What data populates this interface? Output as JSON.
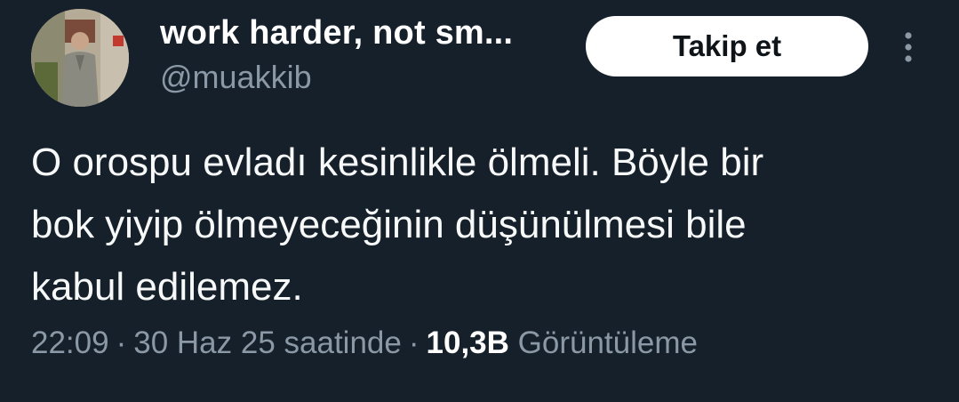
{
  "user": {
    "display_name": "work harder, not sm...",
    "handle": "@muakkib"
  },
  "follow_button": {
    "label": "Takip et"
  },
  "more_button": {
    "icon": "more-vertical-icon"
  },
  "tweet": {
    "text_lines": [
      "O orospu evladı kesinlikle ölmeli. Böyle bir",
      "bok yiyip ölmeyeceğinin düşünülmesi bile",
      "kabul edilemez."
    ]
  },
  "meta": {
    "time": "22:09",
    "separator": "·",
    "date": "30 Haz 25 saatinde",
    "views_count": "10,3B",
    "views_label": "Görüntüleme"
  },
  "colors": {
    "background": "#15202b",
    "text_primary": "#ffffff",
    "text_secondary": "#8b98a5",
    "button_bg": "#ffffff",
    "button_text": "#0f1419"
  }
}
